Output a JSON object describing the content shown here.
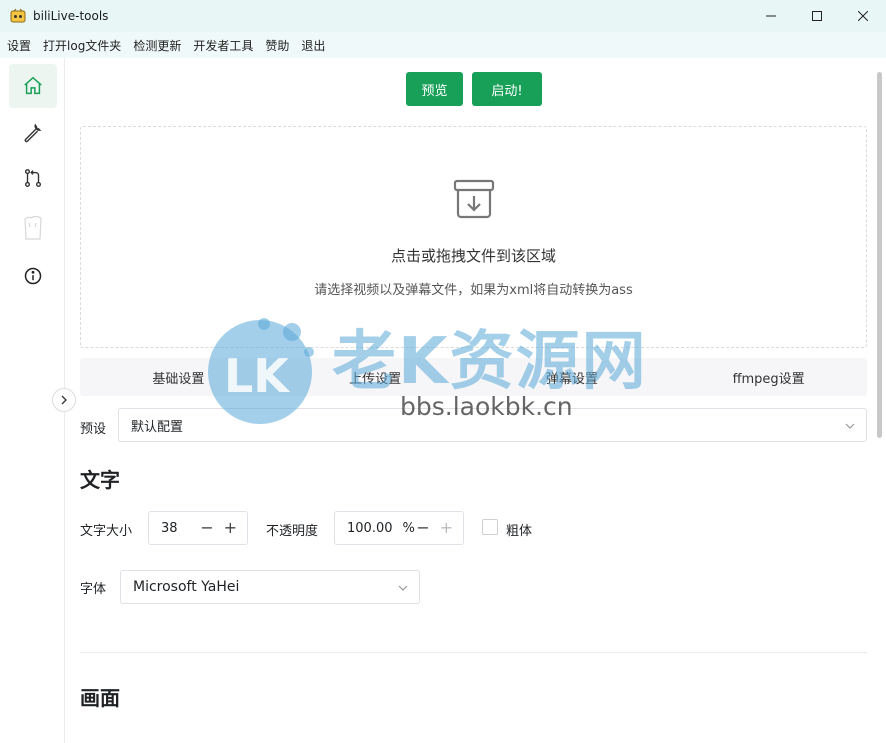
{
  "window": {
    "title": "biliLive-tools"
  },
  "menu": {
    "items": [
      "设置",
      "打开log文件夹",
      "检测更新",
      "开发者工具",
      "赞助",
      "退出"
    ]
  },
  "sidebar": {
    "items": [
      {
        "icon": "home-icon",
        "active": true
      },
      {
        "icon": "wrench-icon",
        "active": false
      },
      {
        "icon": "merge-icon",
        "active": false
      },
      {
        "icon": "bilibili-tv-icon",
        "active": false
      },
      {
        "icon": "info-icon",
        "active": false
      }
    ]
  },
  "actions": {
    "preview": "预览",
    "start": "启动!"
  },
  "upload": {
    "title": "点击或拖拽文件到该区域",
    "hint": "请选择视频以及弹幕文件，如果为xml将自动转换为ass"
  },
  "tabs": [
    "基础设置",
    "上传设置",
    "弹幕设置",
    "ffmpeg设置"
  ],
  "preset": {
    "label": "预设",
    "value": "默认配置"
  },
  "text_section": {
    "title": "文字",
    "font_size_label": "文字大小",
    "font_size_value": "38",
    "opacity_label": "不透明度",
    "opacity_value": "100.00",
    "opacity_unit": "%",
    "bold_label": "粗体",
    "font_label": "字体",
    "font_value": "Microsoft YaHei"
  },
  "canvas_section": {
    "title": "画面"
  },
  "watermark": {
    "text": "老K资源网",
    "url": "bbs.laokbk.cn"
  },
  "colors": {
    "accent": "#18a058",
    "titlebar": "#e8f6f6",
    "watermark": "#5aa8d8"
  }
}
